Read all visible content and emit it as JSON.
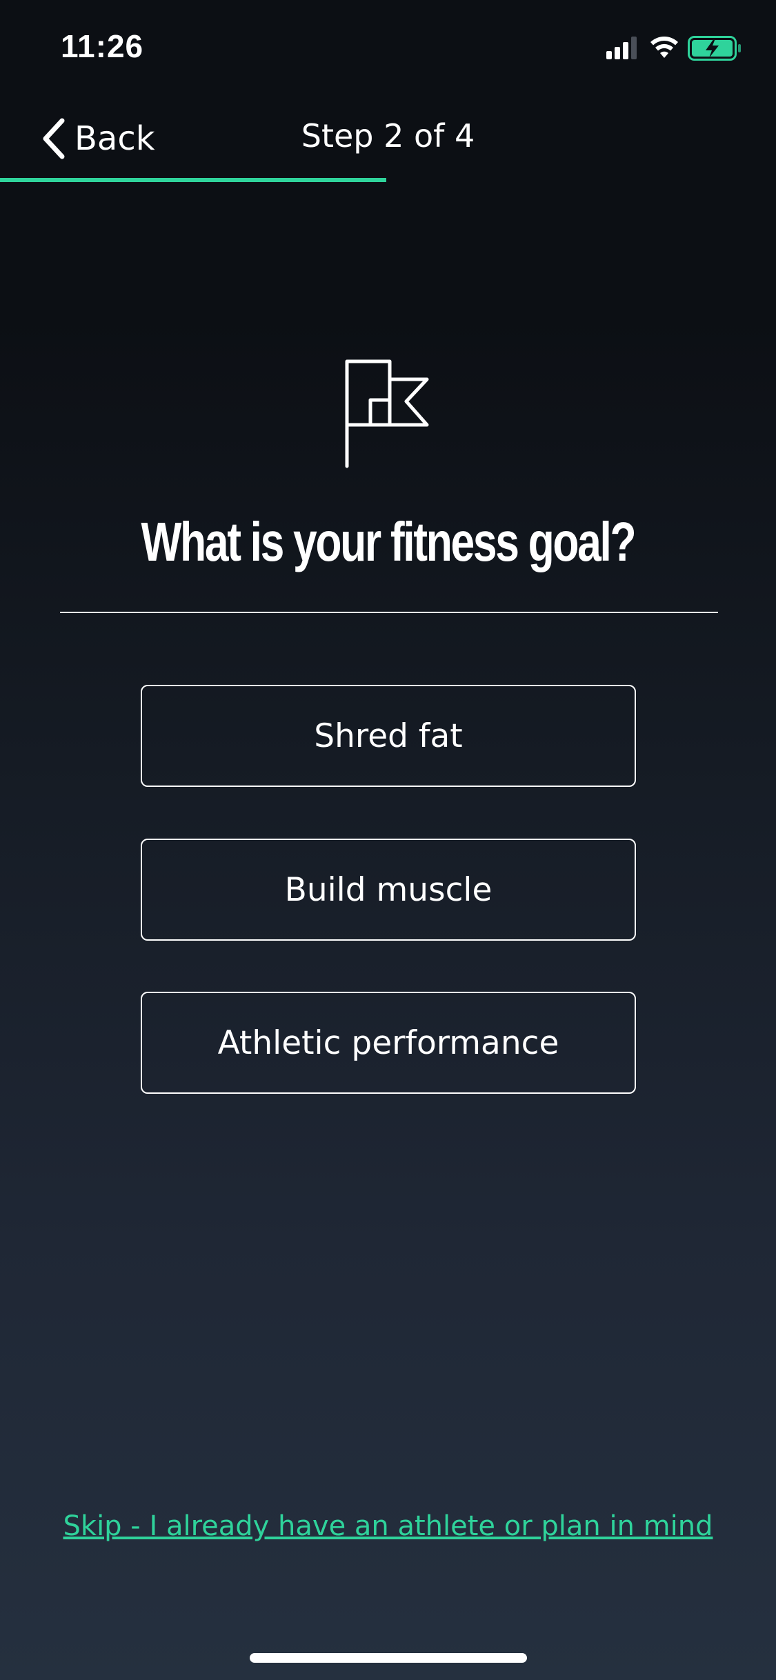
{
  "status_bar": {
    "time": "11:26",
    "icons": [
      "signal-icon",
      "wifi-icon",
      "battery-charging-icon"
    ]
  },
  "nav": {
    "back_label": "Back",
    "step_title": "Step 2 of 4",
    "progress_fraction": 0.5
  },
  "main": {
    "icon": "flag-icon",
    "question": "What is your fitness goal?",
    "options": [
      {
        "label": "Shred fat"
      },
      {
        "label": "Build muscle"
      },
      {
        "label": "Athletic performance"
      }
    ],
    "skip_label": "Skip - I already have an athlete or plan in mind"
  },
  "colors": {
    "accent": "#2fd39b",
    "background_top": "#0c0f14",
    "background_bottom": "#25303f",
    "text": "#ffffff"
  }
}
